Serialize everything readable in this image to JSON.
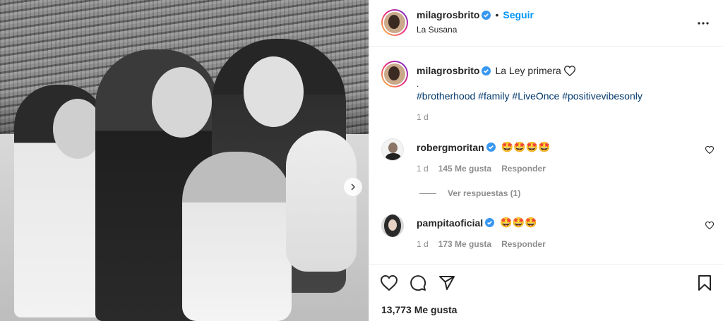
{
  "post": {
    "author": "milagrosbrito",
    "follow_label": "Seguir",
    "location": "La Susana",
    "caption_text": "La Ley primera",
    "caption_dot": ".",
    "hashtags": "#brotherhood #family #LiveOnce #positivevibesonly",
    "time": "1 d",
    "likes": "13,773 Me gusta"
  },
  "comments": [
    {
      "user": "robergmoritan",
      "emoji": "🤩🤩🤩🤩",
      "time": "1 d",
      "likes": "145 Me gusta",
      "reply_label": "Responder",
      "view_replies": "Ver respuestas (1)"
    },
    {
      "user": "pampitaoficial",
      "emoji": "🤩🤩🤩",
      "time": "1 d",
      "likes": "173 Me gusta",
      "reply_label": "Responder"
    }
  ],
  "icons": {
    "more": "more-options-icon",
    "heart": "heart-icon",
    "comment": "comment-icon",
    "share": "share-icon",
    "save": "bookmark-icon",
    "verified": "verified-badge-icon",
    "next": "chevron-right-icon"
  },
  "colors": {
    "accent": "#0095f6",
    "verified": "#3897f0",
    "link": "#00376b",
    "muted": "#8e8e8e"
  }
}
